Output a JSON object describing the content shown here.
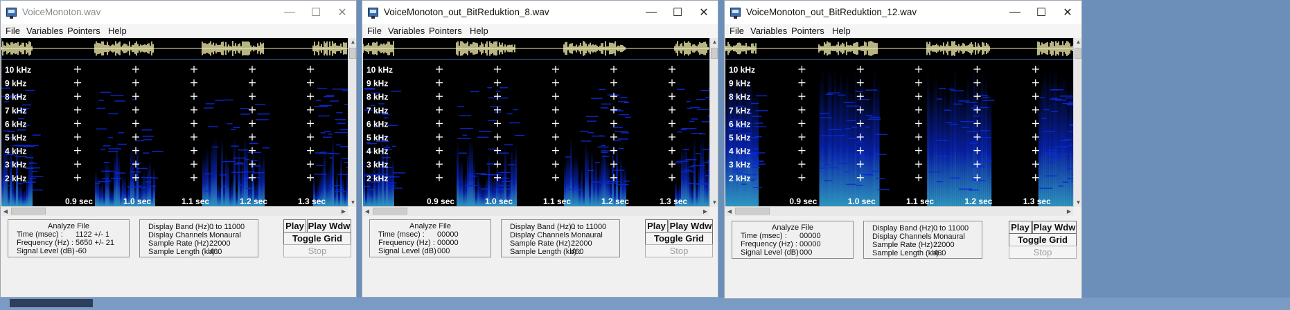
{
  "windows": [
    {
      "title": "VoiceMonoton.wav",
      "active": false,
      "menu": [
        "File",
        "Variables",
        "Pointers",
        "Help"
      ],
      "freq_labels": [
        "10 kHz",
        "9 kHz",
        "8 kHz",
        "7 kHz",
        "6 kHz",
        "5 kHz",
        "4 kHz",
        "3 kHz",
        "2 kHz"
      ],
      "time_labels": [
        "0.9 sec",
        "1.0 sec",
        "1.1 sec",
        "1.2 sec",
        "1.3 sec"
      ],
      "analyze": {
        "heading": "Analyze File",
        "rows": [
          {
            "label": "Time (msec) :",
            "value": "1122 +/- 1"
          },
          {
            "label": "Frequency (Hz) :",
            "value": "5650 +/- 21"
          },
          {
            "label": "Signal Level (dB)",
            "value": "-60"
          }
        ]
      },
      "display": {
        "rows": [
          {
            "label": "Display Band (Hz) :",
            "value": "0 to 11000"
          },
          {
            "label": "Display Channels :",
            "value": "Monaural"
          },
          {
            "label": "Sample Rate (Hz) :",
            "value": "22000"
          },
          {
            "label": "Sample Length (kb) :",
            "value": "460"
          }
        ]
      },
      "buttons": {
        "play": "Play",
        "play_wdw": "Play Wdw",
        "toggle_grid": "Toggle Grid",
        "stop": "Stop"
      }
    },
    {
      "title": "VoiceMonoton_out_BitReduktion_8.wav",
      "active": true,
      "menu": [
        "File",
        "Variables",
        "Pointers",
        "Help"
      ],
      "freq_labels": [
        "10 kHz",
        "9 kHz",
        "8 kHz",
        "7 kHz",
        "6 kHz",
        "5 kHz",
        "4 kHz",
        "3 kHz",
        "2 kHz"
      ],
      "time_labels": [
        "0.9 sec",
        "1.0 sec",
        "1.1 sec",
        "1.2 sec",
        "1.3 sec"
      ],
      "analyze": {
        "heading": "Analyze File",
        "rows": [
          {
            "label": "Time (msec) :",
            "value": "00000"
          },
          {
            "label": "Frequency (Hz) :",
            "value": "00000"
          },
          {
            "label": "Signal Level (dB)",
            "value": "000"
          }
        ]
      },
      "display": {
        "rows": [
          {
            "label": "Display Band (Hz) :",
            "value": "0 to 11000"
          },
          {
            "label": "Display Channels :",
            "value": "Monaural"
          },
          {
            "label": "Sample Rate (Hz) :",
            "value": "22000"
          },
          {
            "label": "Sample Length (kb) :",
            "value": "460"
          }
        ]
      },
      "buttons": {
        "play": "Play",
        "play_wdw": "Play Wdw",
        "toggle_grid": "Toggle Grid",
        "stop": "Stop"
      }
    },
    {
      "title": "VoiceMonoton_out_BitReduktion_12.wav",
      "active": true,
      "menu": [
        "File",
        "Variables",
        "Pointers",
        "Help"
      ],
      "freq_labels": [
        "10 kHz",
        "9 kHz",
        "8 kHz",
        "7 kHz",
        "6 kHz",
        "5 kHz",
        "4 kHz",
        "3 kHz",
        "2 kHz"
      ],
      "time_labels": [
        "0.9 sec",
        "1.0 sec",
        "1.1 sec",
        "1.2 sec",
        "1.3 sec"
      ],
      "analyze": {
        "heading": "Analyze File",
        "rows": [
          {
            "label": "Time (msec) :",
            "value": "00000"
          },
          {
            "label": "Frequency (Hz) :",
            "value": "00000"
          },
          {
            "label": "Signal Level (dB)",
            "value": "000"
          }
        ]
      },
      "display": {
        "rows": [
          {
            "label": "Display Band (Hz) :",
            "value": "0 to 11000"
          },
          {
            "label": "Display Channels :",
            "value": "Monaural"
          },
          {
            "label": "Sample Rate (Hz) :",
            "value": "22000"
          },
          {
            "label": "Sample Length (kb) :",
            "value": "460"
          }
        ]
      },
      "buttons": {
        "play": "Play",
        "play_wdw": "Play Wdw",
        "toggle_grid": "Toggle Grid",
        "stop": "Stop"
      }
    }
  ],
  "colors": {
    "spectrogram_bg": "#000000",
    "spectrogram_low": "#0a2ad8",
    "spectrogram_high": "#3ec7ff",
    "waveform": "#f4f0b0",
    "grid_text": "#ffffff"
  },
  "icons": {
    "app": "app-window-icon",
    "minimize": "minimize-icon",
    "maximize": "maximize-icon",
    "close": "close-icon"
  }
}
